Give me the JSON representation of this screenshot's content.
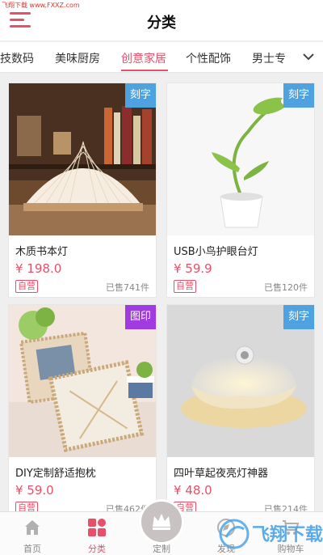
{
  "watermark": "飞翔下载 www.FXXZ.com",
  "header": {
    "title": "分类"
  },
  "tabs": [
    {
      "label": "技数码",
      "active": false
    },
    {
      "label": "美味厨房",
      "active": false
    },
    {
      "label": "创意家居",
      "active": true
    },
    {
      "label": "个性配饰",
      "active": false
    },
    {
      "label": "男士专",
      "active": false
    }
  ],
  "products": [
    {
      "name": "木质书本灯",
      "price": "¥ 198.0",
      "tag": "自营",
      "sold": "已售741件",
      "badge": "刻字",
      "badge_color": "#4ea2e0"
    },
    {
      "name": "USB小鸟护眼台灯",
      "price": "¥ 59.9",
      "tag": "自营",
      "sold": "已售120件",
      "badge": "刻字",
      "badge_color": "#4ea2e0"
    },
    {
      "name": "DIY定制舒适抱枕",
      "price": "¥ 59.0",
      "tag": "自营",
      "sold": "已售462件",
      "badge": "图印",
      "badge_color": "#a03be0"
    },
    {
      "name": "四叶草起夜亮灯神器",
      "price": "¥ 48.0",
      "tag": "自营",
      "sold": "已售214件",
      "badge": "刻字",
      "badge_color": "#4ea2e0"
    }
  ],
  "bottom_nav": [
    {
      "label": "首页",
      "icon": "home-icon",
      "active": false
    },
    {
      "label": "分类",
      "icon": "category-icon",
      "active": true
    },
    {
      "label": "定制",
      "icon": "crown-icon",
      "active": false
    },
    {
      "label": "发现",
      "icon": "discover-icon",
      "active": false
    },
    {
      "label": "购物车",
      "icon": "cart-icon",
      "active": false
    }
  ],
  "bottom_watermark": "飞翔下载",
  "accent_color": "#e8506a"
}
